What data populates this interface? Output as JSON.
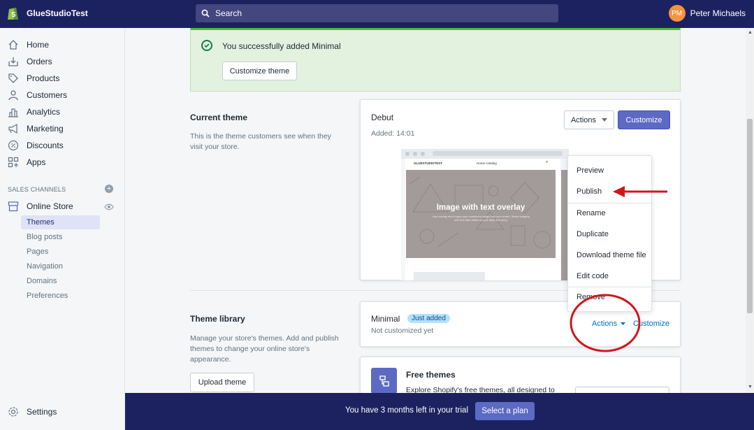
{
  "topbar": {
    "store_name": "GlueStudioTest",
    "search_placeholder": "Search",
    "user_initials": "PM",
    "user_name": "Peter Michaels"
  },
  "sidebar": {
    "items": [
      {
        "label": "Home",
        "icon": "home-icon"
      },
      {
        "label": "Orders",
        "icon": "orders-icon"
      },
      {
        "label": "Products",
        "icon": "tag-icon"
      },
      {
        "label": "Customers",
        "icon": "person-icon"
      },
      {
        "label": "Analytics",
        "icon": "bar-chart-icon"
      },
      {
        "label": "Marketing",
        "icon": "megaphone-icon"
      },
      {
        "label": "Discounts",
        "icon": "discount-icon"
      },
      {
        "label": "Apps",
        "icon": "apps-icon"
      }
    ],
    "sales_channels_heading": "SALES CHANNELS",
    "online_store_label": "Online Store",
    "sub_items": [
      "Themes",
      "Blog posts",
      "Pages",
      "Navigation",
      "Domains",
      "Preferences"
    ],
    "active_sub_item": "Themes",
    "settings_label": "Settings"
  },
  "banner": {
    "message": "You successfully added Minimal",
    "customize_button": "Customize theme"
  },
  "current_theme": {
    "section_title": "Current theme",
    "section_desc": "This is the theme customers see when they visit your store.",
    "theme_name": "Debut",
    "added": "Added: 14:01",
    "actions_button": "Actions",
    "customize_button": "Customize",
    "preview_store": "GLUESTUDIOTEST",
    "preview_nav": "Home   Catalog",
    "preview_hero_title": "Image with text overlay",
    "preview_hero_sub": "Use overlay text to give your customers insight into your brand. Select imagery and text that relates to your style and story."
  },
  "dropdown": {
    "items": [
      "Preview",
      "Publish",
      "Rename",
      "Duplicate",
      "Download theme file",
      "Edit code",
      "Remove"
    ]
  },
  "theme_library": {
    "section_title": "Theme library",
    "section_desc": "Manage your store's themes. Add and publish themes to change your online store's appearance.",
    "upload_button": "Upload theme",
    "theme_name": "Minimal",
    "badge": "Just added",
    "status": "Not customized yet",
    "actions_link": "Actions",
    "customize_link": "Customize"
  },
  "free_themes": {
    "title": "Free themes",
    "desc": "Explore Shopify's free themes, all designed to"
  },
  "trial": {
    "message": "You have 3 months left in your trial",
    "button": "Select a plan"
  },
  "colors": {
    "topbar": "#1c2260",
    "primary": "#5c6ac4",
    "success": "#50b83c",
    "annotation": "#d0161b"
  }
}
